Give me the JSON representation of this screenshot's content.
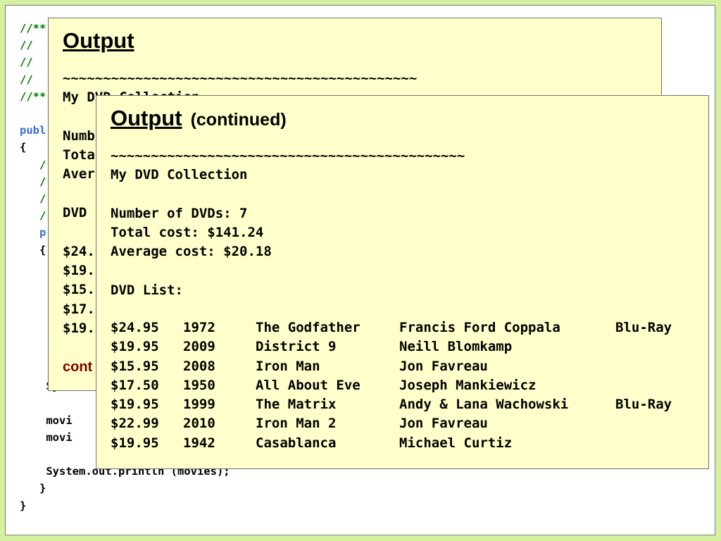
{
  "background_code": {
    "lines": [
      "//**",
      "//",
      "//",
      "//",
      "//**",
      "",
      "publ",
      "{",
      "   /",
      "   /",
      "   /",
      "   /",
      "   p",
      "   {",
      "",
      "",
      "",
      "",
      "",
      "",
      "",
      "    Syst",
      "",
      "    movi",
      "    movi",
      "",
      "    System.out.println (movies);",
      "   }",
      "}"
    ]
  },
  "panel1": {
    "title": "Output",
    "lines": [
      "~~~~~~~~~~~~~~~~~~~~~~~~~~~~~~~~~~~~~~~~~~~~",
      "My DVD Collection",
      "",
      "Numb",
      "Tota",
      "Aver",
      "",
      "DVD",
      "",
      "$24.",
      "$19.",
      "$15.",
      "$17.",
      "$19."
    ],
    "continued_label": "cont"
  },
  "panel2": {
    "title": "Output",
    "subtitle": "(continued)",
    "tilde_line": "~~~~~~~~~~~~~~~~~~~~~~~~~~~~~~~~~~~~~~~~~~~~",
    "heading": "My DVD Collection",
    "count_line": "Number of DVDs: 7",
    "total_line": "Total cost: $141.24",
    "average_line": "Average cost: $20.18",
    "list_label": "DVD List:",
    "dvds": [
      {
        "cost": "$24.95",
        "year": "1972",
        "title": "The Godfather",
        "director": "Francis Ford Coppala",
        "format": "Blu-Ray"
      },
      {
        "cost": "$19.95",
        "year": "2009",
        "title": "District 9",
        "director": "Neill Blomkamp",
        "format": ""
      },
      {
        "cost": "$15.95",
        "year": "2008",
        "title": "Iron Man",
        "director": "Jon Favreau",
        "format": ""
      },
      {
        "cost": "$17.50",
        "year": "1950",
        "title": "All About Eve",
        "director": "Joseph Mankiewicz",
        "format": ""
      },
      {
        "cost": "$19.95",
        "year": "1999",
        "title": "The Matrix",
        "director": "Andy & Lana Wachowski",
        "format": "Blu-Ray"
      },
      {
        "cost": "$22.99",
        "year": "2010",
        "title": "Iron Man 2",
        "director": "Jon Favreau",
        "format": ""
      },
      {
        "cost": "$19.95",
        "year": "1942",
        "title": "Casablanca",
        "director": "Michael Curtiz",
        "format": ""
      }
    ]
  },
  "colors": {
    "slide_border_bg": "#d4f0a0",
    "panel_bg": "#ffffcc",
    "comment": "#007a00",
    "keyword": "#3a6fd8",
    "continued_label": "#7a0000"
  }
}
